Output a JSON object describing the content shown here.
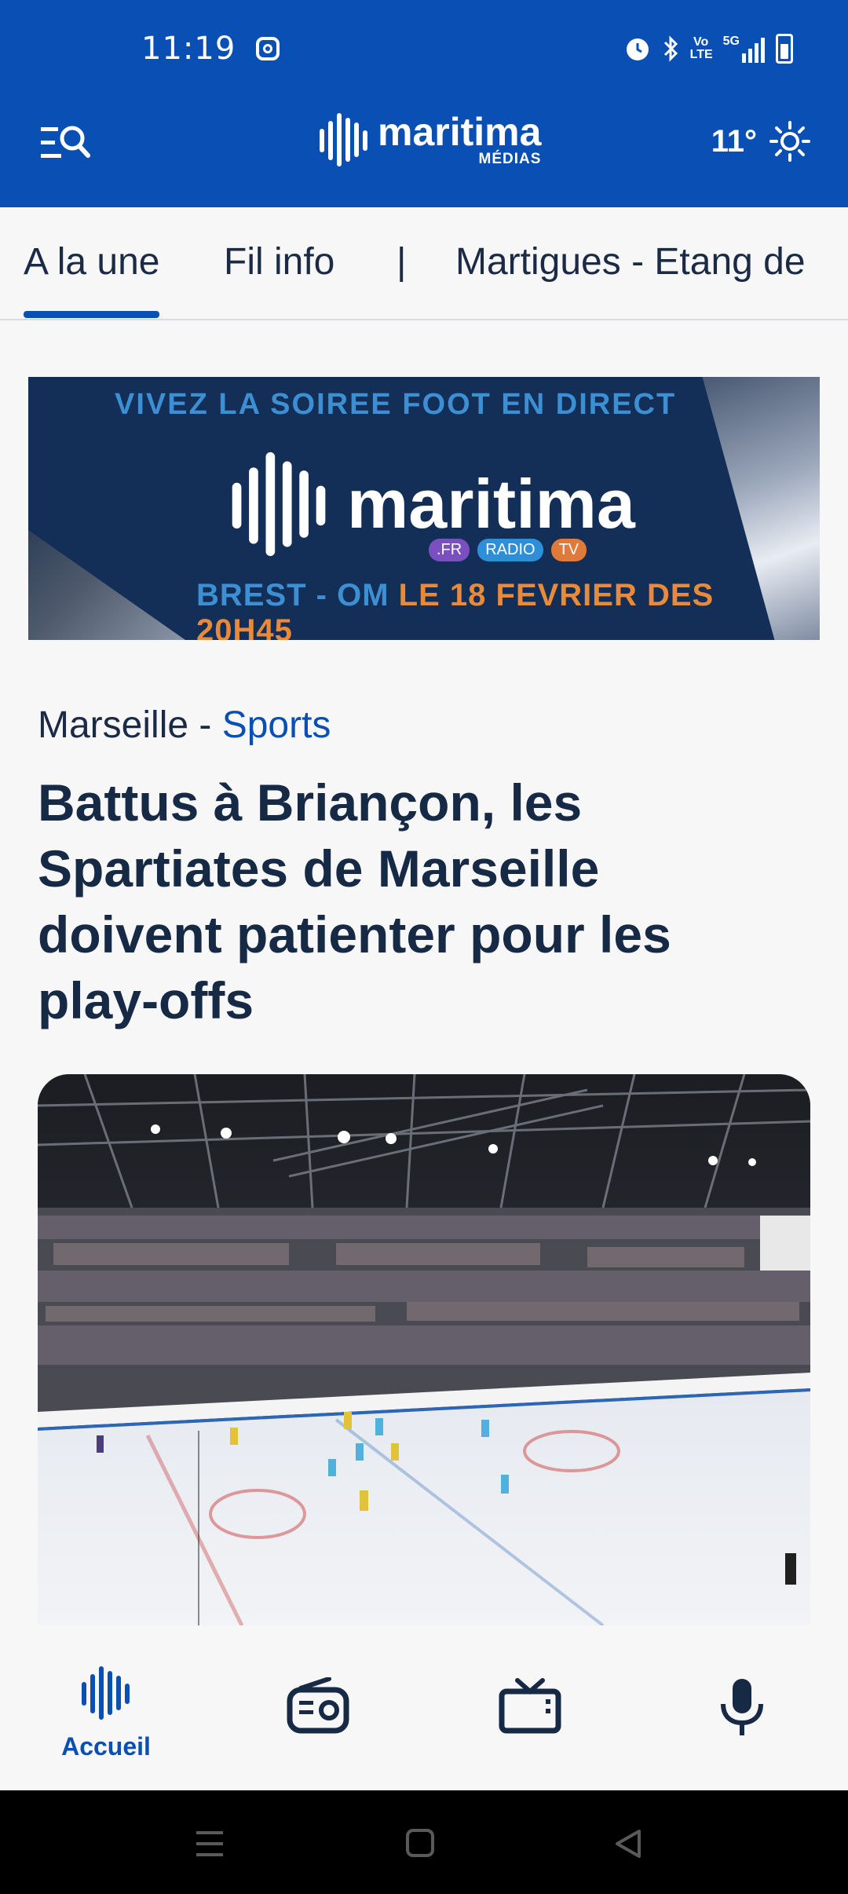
{
  "status_bar": {
    "time": "11:19",
    "icons": [
      "instagram-icon",
      "alarm-icon",
      "bluetooth-icon",
      "volte-icon",
      "5g-signal-icon",
      "battery-icon"
    ],
    "volte": "Vo LTE",
    "network": "5G"
  },
  "app_bar": {
    "brand": "maritima",
    "brand_sub": "MÉDIAS",
    "temperature": "11°",
    "icons": [
      "menu-search-icon",
      "weather-sun-icon"
    ]
  },
  "tabs": [
    {
      "label": "A la une",
      "active": true
    },
    {
      "label": "Fil info",
      "active": false
    },
    {
      "label": "|",
      "active": false
    },
    {
      "label": "Martigues - Etang de",
      "active": false
    }
  ],
  "ad_banner": {
    "headline": "VIVEZ LA SOIREE FOOT EN DIRECT",
    "brand": "maritima",
    "pills": [
      ".FR",
      "RADIO",
      "TV"
    ],
    "bottom_blue": "BREST - OM ",
    "bottom_orange": "LE 18 FEVRIER DES 20H45",
    "colors": {
      "background": "#142f57",
      "blue_text": "#3c8fd2",
      "orange_text": "#e88a3a"
    }
  },
  "article": {
    "location": "Marseille - ",
    "category": "Sports",
    "title": "Battus à Briançon, les Spartiates de Marseille doivent patienter pour les play-offs"
  },
  "bottom_nav": [
    {
      "label": "Accueil",
      "icon": "maritima-wave-icon",
      "active": true
    },
    {
      "label": "",
      "icon": "radio-icon",
      "active": false
    },
    {
      "label": "",
      "icon": "tv-icon",
      "active": false
    },
    {
      "label": "",
      "icon": "microphone-icon",
      "active": false
    }
  ],
  "system_nav": [
    "recents-icon",
    "home-icon",
    "back-icon"
  ],
  "colors": {
    "brand_blue": "#0a4fb3",
    "title_text": "#162a46"
  }
}
